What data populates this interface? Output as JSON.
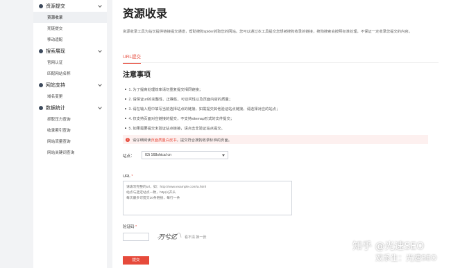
{
  "sidebar": {
    "sections": [
      {
        "title": "资源提交",
        "items": [
          {
            "label": "资源收录",
            "active": true
          },
          {
            "label": "死链提交",
            "active": false
          },
          {
            "label": "移动适配",
            "active": false
          }
        ]
      },
      {
        "title": "搜索展现",
        "items": [
          {
            "label": "官网认证",
            "active": false
          },
          {
            "label": "匹配网站名称",
            "active": false
          }
        ]
      },
      {
        "title": "网站支持",
        "items": [
          {
            "label": "域名变更",
            "active": false
          }
        ]
      },
      {
        "title": "数据统计",
        "items": [
          {
            "label": "抓取压力查询",
            "active": false
          },
          {
            "label": "收录索引查询",
            "active": false
          },
          {
            "label": "网站流量查询",
            "active": false
          },
          {
            "label": "网站关键词查询",
            "active": false
          }
        ]
      }
    ]
  },
  "main": {
    "title": "资源收录",
    "intro": "资源收录工具为站长提供链接提交通道，帮助搜狗spider抓取您的网站。您可以通过本工具提交您想被搜狗收录的链接，搜狗搜索会按照标准处理，不保证一定收录您提交的内容。",
    "tab": "URL提交",
    "notice_title": "注意事项",
    "notices": [
      "1. 为了提高处理效率请勿重复提交相同链接；",
      "2. 请保证url的完整性、正确性、可访问性以及页面内容的质量；",
      "3. 请在输入框中填写当前选择站点的链接，如需提交其他验证站点链接，请选择对应的站点；",
      "4. 仅支持页面对应链接的提交，不支持sitemap形式的文件提交；",
      "5. 如果需要提交未验证站点链接，请点击非验证站点提交。"
    ],
    "warn": {
      "prefix": "请仔细阅读",
      "link": "页面质量白皮书",
      "suffix": "，提交符合搜狗收录标准的页面。",
      "icon": "!"
    },
    "site_label": "站点：",
    "site_value": "02i 168shical cn",
    "url_label": "URL",
    "url_required": "*",
    "url_placeholder": "请填写完整的url，如：http://www.example.com/a.html\n站点与选定站点一致，http(s)开头\n每次最多可提交20条链接，每行一条",
    "captcha_label": "验证码",
    "captcha_required": "*",
    "captcha_text": "万兮忆",
    "captcha_refresh": "看不清 换一张",
    "submit_label": "提交"
  },
  "watermark": {
    "line1": "知乎 @光速SEO",
    "line2": "双系生：光速SEO"
  }
}
